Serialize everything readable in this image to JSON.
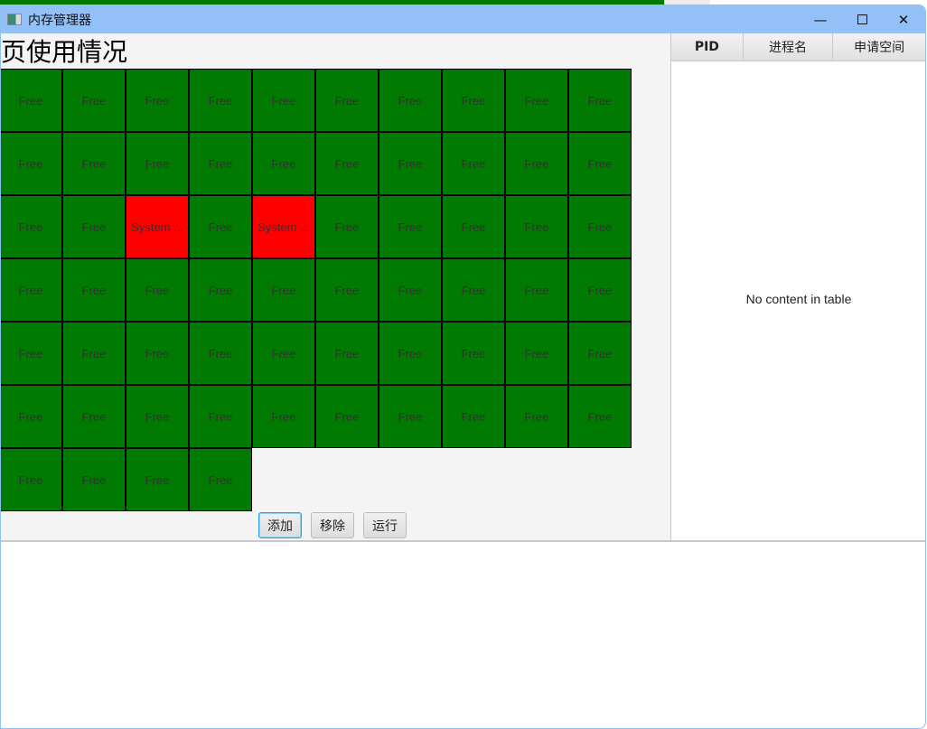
{
  "window": {
    "title": "内存管理器",
    "minimize_icon": "minimize-icon",
    "maximize_icon": "maximize-icon",
    "close_icon": "close-icon"
  },
  "main": {
    "heading": "页使用情况",
    "colors": {
      "free": "#007a00",
      "used": "#ff0000",
      "border": "#000000"
    },
    "cells": [
      "Free",
      "Free",
      "Free",
      "Free",
      "Free",
      "Free",
      "Free",
      "Free",
      "Free",
      "Free",
      "Free",
      "Free",
      "Free",
      "Free",
      "Free",
      "Free",
      "Free",
      "Free",
      "Free",
      "Free",
      "Free",
      "Free",
      "System ...",
      "Free",
      "System ...",
      "Free",
      "Free",
      "Free",
      "Free",
      "Free",
      "Free",
      "Free",
      "Free",
      "Free",
      "Free",
      "Free",
      "Free",
      "Free",
      "Free",
      "Free",
      "Free",
      "Free",
      "Free",
      "Free",
      "Free",
      "Free",
      "Free",
      "Free",
      "Free",
      "Free",
      "Free",
      "Free",
      "Free",
      "Free",
      "Free",
      "Free",
      "Free",
      "Free",
      "Free",
      "Free",
      "Free",
      "Free",
      "Free",
      "Free"
    ],
    "buttons": {
      "add": "添加",
      "remove": "移除",
      "run": "运行"
    }
  },
  "table": {
    "columns": [
      "PID",
      "进程名",
      "申请空间"
    ],
    "empty_text": "No content in table"
  }
}
